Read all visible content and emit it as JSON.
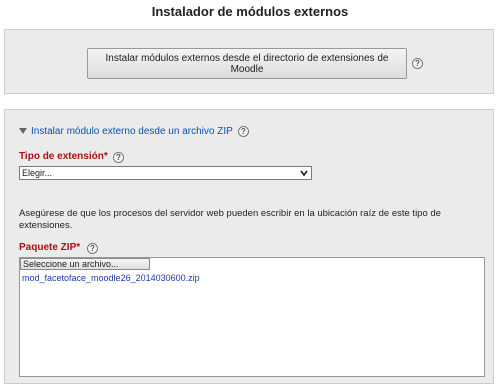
{
  "page": {
    "title": "Instalador de módulos externos"
  },
  "marketplace": {
    "button_label": "Instalar módulos externos desde el directorio de extensiones de Moodle",
    "help_icon": "question-circle"
  },
  "zip_section": {
    "legend": "Instalar módulo externo desde un archivo ZIP",
    "collapse_icon": "triangle-down",
    "plugin_type": {
      "label": "Tipo de extensión",
      "required_mark": "*",
      "selected": "Elegir..."
    },
    "notice": "Asegúrese de que los procesos del servidor web pueden escribir en la ubicación raíz de este tipo de extensiones.",
    "zip_package": {
      "label": "Paquete ZIP",
      "required_mark": "*",
      "choose_button": "Seleccione un archivo...",
      "file_name": "mod_facetoface_moodle26_2014030600.zip"
    }
  },
  "colors": {
    "label_red": "#aa1111",
    "link_blue": "#0a4fb5",
    "panel_bg": "#ebebeb"
  }
}
